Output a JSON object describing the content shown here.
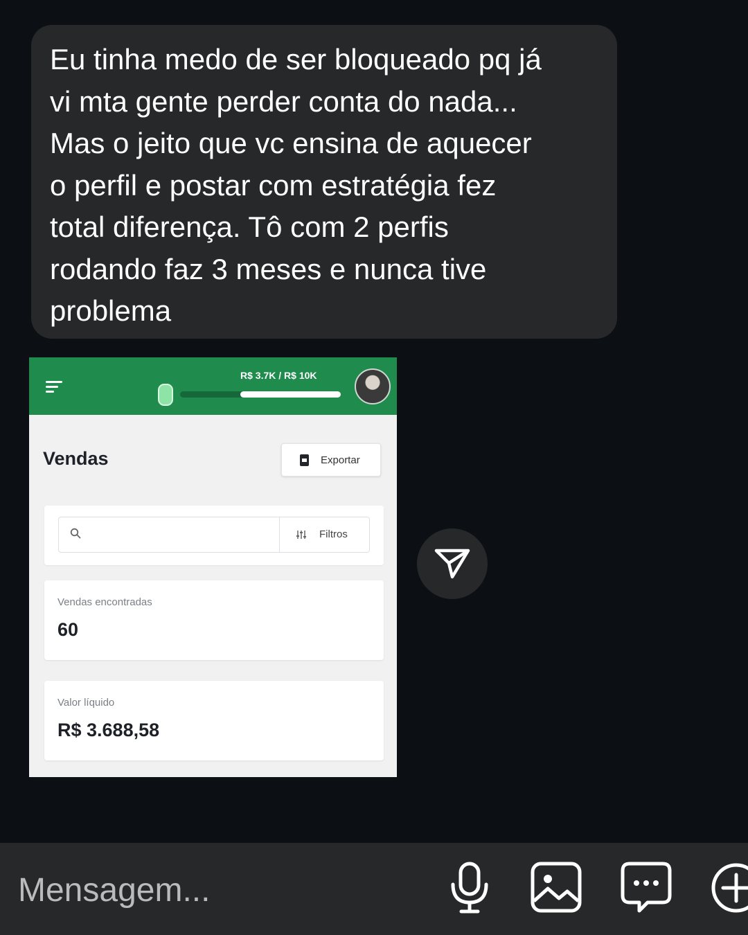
{
  "message": {
    "text": "Eu tinha medo de ser bloqueado pq já\nvi mta gente perder conta do nada...\nMas o jeito que vc ensina de aquecer\no perfil e postar com estratégia fez\ntotal diferença. Tô com 2 perfis\nrodando faz 3 meses e nunca tive\nproblema"
  },
  "screenshot": {
    "header": {
      "goal_label": "R$ 3.7K / R$ 10K",
      "goal_progress_fraction": 0.37,
      "icons": [
        "menu-icon",
        "pill-icon",
        "avatar"
      ]
    },
    "page_title": "Vendas",
    "export_label": "Exportar",
    "search": {
      "placeholder": "",
      "filter_label": "Filtros"
    },
    "stats": [
      {
        "label": "Vendas encontradas",
        "value": "60"
      },
      {
        "label": "Valor líquido",
        "value": "R$ 3.688,58"
      }
    ],
    "colors": {
      "header": "#1f8b4c",
      "background": "#f1f1f2"
    }
  },
  "composer": {
    "placeholder": "Mensagem...",
    "icons": [
      "microphone-icon",
      "gallery-icon",
      "sticker-icon",
      "add-icon"
    ]
  },
  "colors": {
    "background": "#0c0f14",
    "bubble": "#262829",
    "text": "#ffffff"
  }
}
